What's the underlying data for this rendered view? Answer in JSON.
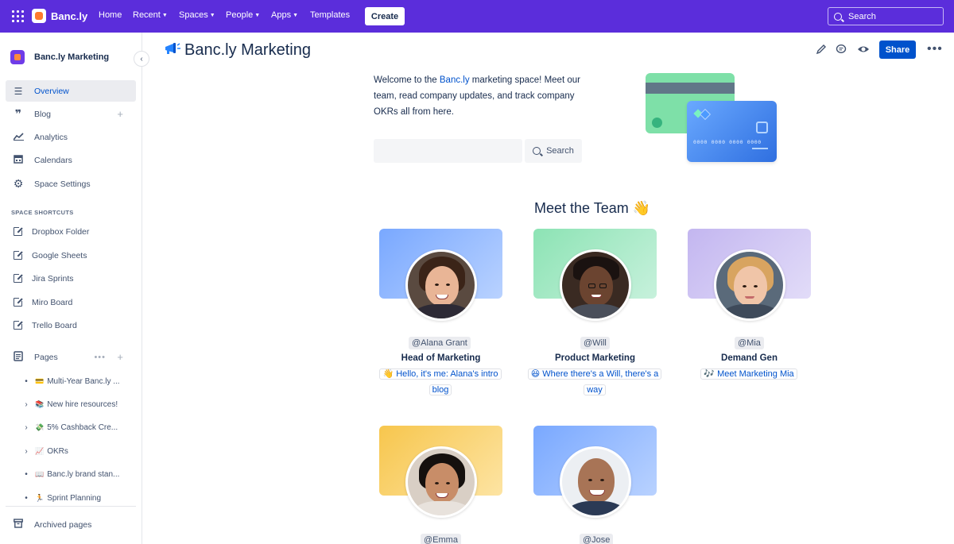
{
  "topnav": {
    "brand": "Banc.ly",
    "items": [
      {
        "label": "Home",
        "dropdown": false
      },
      {
        "label": "Recent",
        "dropdown": true
      },
      {
        "label": "Spaces",
        "dropdown": true
      },
      {
        "label": "People",
        "dropdown": true
      },
      {
        "label": "Apps",
        "dropdown": true
      },
      {
        "label": "Templates",
        "dropdown": false
      }
    ],
    "create_label": "Create",
    "search_placeholder": "Search"
  },
  "sidebar": {
    "space_name": "Banc.ly Marketing",
    "nav": [
      {
        "label": "Overview",
        "icon": "lines-icon",
        "active": true
      },
      {
        "label": "Blog",
        "icon": "quote-icon",
        "active": false
      },
      {
        "label": "Analytics",
        "icon": "chart-line-icon",
        "active": false
      },
      {
        "label": "Calendars",
        "icon": "calendar-icon",
        "active": false
      },
      {
        "label": "Space Settings",
        "icon": "gear-icon",
        "active": false
      }
    ],
    "shortcuts_heading": "SPACE SHORTCUTS",
    "shortcuts": [
      "Dropbox Folder",
      "Google Sheets",
      "Jira Sprints",
      "Miro Board",
      "Trello Board"
    ],
    "pages_label": "Pages",
    "pages": [
      {
        "marker": "•",
        "emoji": "💳",
        "title": "Multi-Year Banc.ly ..."
      },
      {
        "marker": "›",
        "emoji": "📚",
        "title": "New hire resources!"
      },
      {
        "marker": "›",
        "emoji": "💸",
        "title": "5% Cashback Cre..."
      },
      {
        "marker": "›",
        "emoji": "📈",
        "title": "OKRs"
      },
      {
        "marker": "•",
        "emoji": "📖",
        "title": "Banc.ly brand stan..."
      },
      {
        "marker": "•",
        "emoji": "🏃",
        "title": "Sprint Planning"
      }
    ],
    "archived_label": "Archived pages"
  },
  "page": {
    "icon": "megaphone-icon",
    "title": "Banc.ly Marketing",
    "share_label": "Share",
    "welcome_pre": "Welcome to the ",
    "welcome_link": "Banc.ly",
    "welcome_post": " marketing space! Meet our team, read company updates, and track company OKRs all from here.",
    "search_button": "Search",
    "card_number": "0000 0000 0000 0000",
    "team_heading": "Meet the Team 👋"
  },
  "team": [
    {
      "handle": "@Alana Grant",
      "role": "Head of Marketing",
      "intro": "👋 Hello, it's me: Alana's intro blog",
      "color": "#79a8ff"
    },
    {
      "handle": "@Will",
      "role": "Product Marketing",
      "intro": "😆 Where there's a Will, there's a way",
      "color": "#8ce3b4"
    },
    {
      "handle": "@Mia",
      "role": "Demand Gen",
      "intro": "🎶 Meet Marketing Mia",
      "color": "#c3b6f0"
    },
    {
      "handle": "@Emma",
      "role": "",
      "intro": "",
      "color": "#f7c64d"
    },
    {
      "handle": "@Jose",
      "role": "",
      "intro": "",
      "color": "#79a8ff"
    }
  ],
  "colors": {
    "nav_bg": "#5b2ddb",
    "primary": "#0052cc",
    "text": "#172b4d"
  }
}
